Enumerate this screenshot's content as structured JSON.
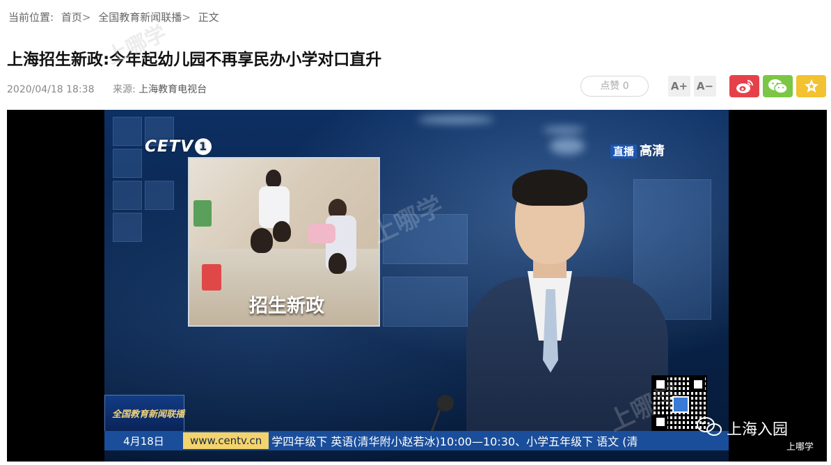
{
  "breadcrumb": {
    "label": "当前位置:",
    "items": [
      "首页",
      "全国教育新闻联播",
      "正文"
    ],
    "sep": ">"
  },
  "article": {
    "title": "上海招生新政:今年起幼儿园不再享民办小学对口直升",
    "datetime": "2020/04/18 18:38",
    "source_label": "来源:",
    "source": "上海教育电视台"
  },
  "toolbar": {
    "like_label": "点赞",
    "like_count": "0",
    "font_increase": "A+",
    "font_decrease": "A−",
    "share": [
      {
        "icon": "weibo-icon",
        "color": "#e6414a"
      },
      {
        "icon": "wechat-icon",
        "color": "#7bc745"
      },
      {
        "icon": "star-icon",
        "color": "#f2c230"
      }
    ]
  },
  "video": {
    "channel_logo": "CETV",
    "channel_number": "1",
    "live_tag": "直播",
    "hd_label": "高清",
    "inset_caption": "招生新政",
    "ticker_date": "4月18日",
    "ticker_site": "www.centv.cn",
    "ticker_text": "学四年级下 英语(清华附小赵若冰)10:00—10:30、小学五年级下 语文 (清",
    "news_badge": "全国教育新闻联播",
    "watermark_name": "上海入园",
    "watermark_sub": "上哪学"
  },
  "colors": {
    "brand_blue": "#0d2f62",
    "ticker_blue": "#1a4e9a",
    "ticker_yellow": "#f3d46c"
  }
}
